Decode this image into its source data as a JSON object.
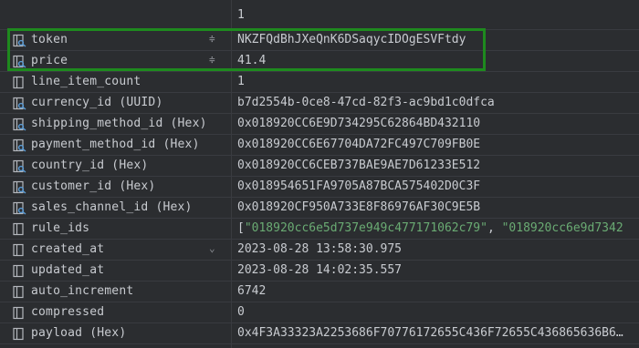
{
  "header": {
    "column_number": "1"
  },
  "rows": [
    {
      "name": "token",
      "icon": "key-column-icon",
      "sort": "≑",
      "value": "NKZFQdBhJXeQnK6DSaqycIDOgESVFtdy"
    },
    {
      "name": "price",
      "icon": "key-column-icon",
      "sort": "≑",
      "value": "41.4"
    },
    {
      "name": "line_item_count",
      "icon": "column-icon",
      "sort": "",
      "value": "1"
    },
    {
      "name": "currency_id (UUID)",
      "icon": "key-column-icon",
      "sort": "",
      "value": "b7d2554b-0ce8-47cd-82f3-ac9bd1c0dfca"
    },
    {
      "name": "shipping_method_id (Hex)",
      "icon": "key-column-icon",
      "sort": "",
      "value": "0x018920CC6E9D734295C62864BD432110"
    },
    {
      "name": "payment_method_id (Hex)",
      "icon": "key-column-icon",
      "sort": "",
      "value": "0x018920CC6E67704DA72FC497C709FB0E"
    },
    {
      "name": "country_id (Hex)",
      "icon": "key-column-icon",
      "sort": "",
      "value": "0x018920CC6CEB737BAE9AE7D61233E512"
    },
    {
      "name": "customer_id (Hex)",
      "icon": "key-column-icon",
      "sort": "",
      "value": "0x018954651FA9705A87BCA575402D0C3F"
    },
    {
      "name": "sales_channel_id (Hex)",
      "icon": "key-column-icon",
      "sort": "",
      "value": "0x018920CF950A733E8F86976AF30C9E5B"
    },
    {
      "name": "rule_ids",
      "icon": "column-icon",
      "sort": "",
      "value_parts": [
        "[",
        "\"018920cc6e5d737e949c477171062c79\"",
        ", ",
        "\"018920cc6e9d7342"
      ]
    },
    {
      "name": "created_at",
      "icon": "column-icon",
      "sort": "⌄",
      "value": "2023-08-28 13:58:30.975"
    },
    {
      "name": "updated_at",
      "icon": "column-icon",
      "sort": "",
      "value": "2023-08-28 14:02:35.557"
    },
    {
      "name": "auto_increment",
      "icon": "column-icon",
      "sort": "",
      "value": "6742"
    },
    {
      "name": "compressed",
      "icon": "column-icon",
      "sort": "",
      "value": "0"
    },
    {
      "name": "payload (Hex)",
      "icon": "column-icon",
      "sort": "",
      "value": "0x4F3A33323A2253686F70776172655C436F72655C436865636B6…"
    }
  ],
  "colors": {
    "background": "#2b2d30",
    "grid_line": "#393b40",
    "text": "#c8cbd0",
    "string_value": "#6aab73",
    "key_icon": "#5a9bd5",
    "highlight_border": "#1e8a1e"
  }
}
